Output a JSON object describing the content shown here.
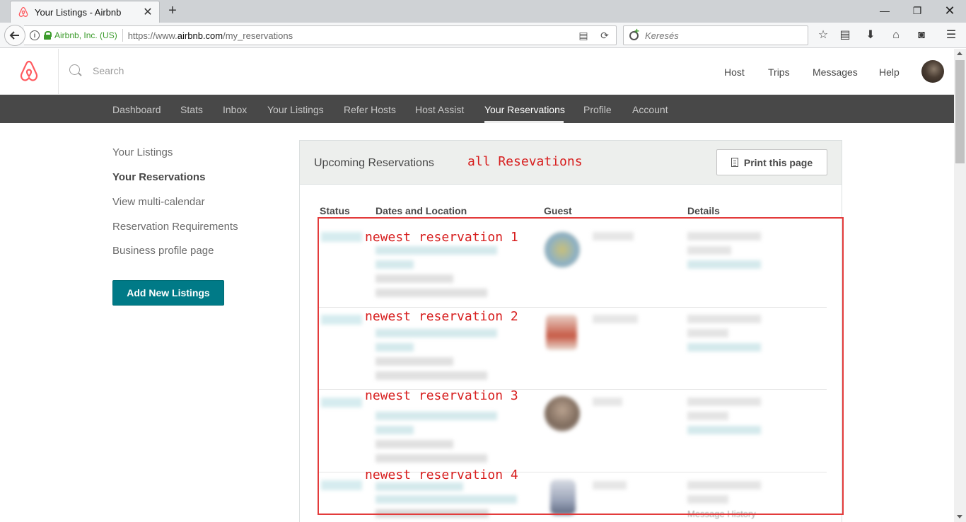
{
  "browser": {
    "tab_title": "Your Listings - Airbnb",
    "identity": "Airbnb, Inc. (US)",
    "url_prefix": "https://www.",
    "url_domain": "airbnb.com",
    "url_path": "/my_reservations",
    "search_placeholder": "Keresés"
  },
  "header": {
    "search_placeholder": "Search",
    "links": {
      "host": "Host",
      "trips": "Trips",
      "messages": "Messages",
      "help": "Help"
    },
    "brand_color": "#ff5a5f"
  },
  "subnav": {
    "items": [
      "Dashboard",
      "Stats",
      "Inbox",
      "Your Listings",
      "Refer Hosts",
      "Host Assist",
      "Your Reservations",
      "Profile",
      "Account"
    ],
    "active": "Your Reservations"
  },
  "sidebar": {
    "links": [
      "Your Listings",
      "Your Reservations",
      "View multi-calendar",
      "Reservation Requirements",
      "Business profile page"
    ],
    "active": "Your Reservations",
    "add_button": "Add New Listings",
    "accent_color": "#007a87"
  },
  "panel": {
    "title": "Upcoming Reservations",
    "print_button": "Print this page",
    "columns": [
      "Status",
      "Dates and Location",
      "Guest",
      "Details"
    ],
    "visible_detail_text": "Message History"
  },
  "annotations": {
    "title": "all Resevations",
    "rows": [
      "newest reservation 1",
      "newest reservation 2",
      "newest reservation 3",
      "newest reservation 4"
    ],
    "color": "#d71e1e"
  }
}
